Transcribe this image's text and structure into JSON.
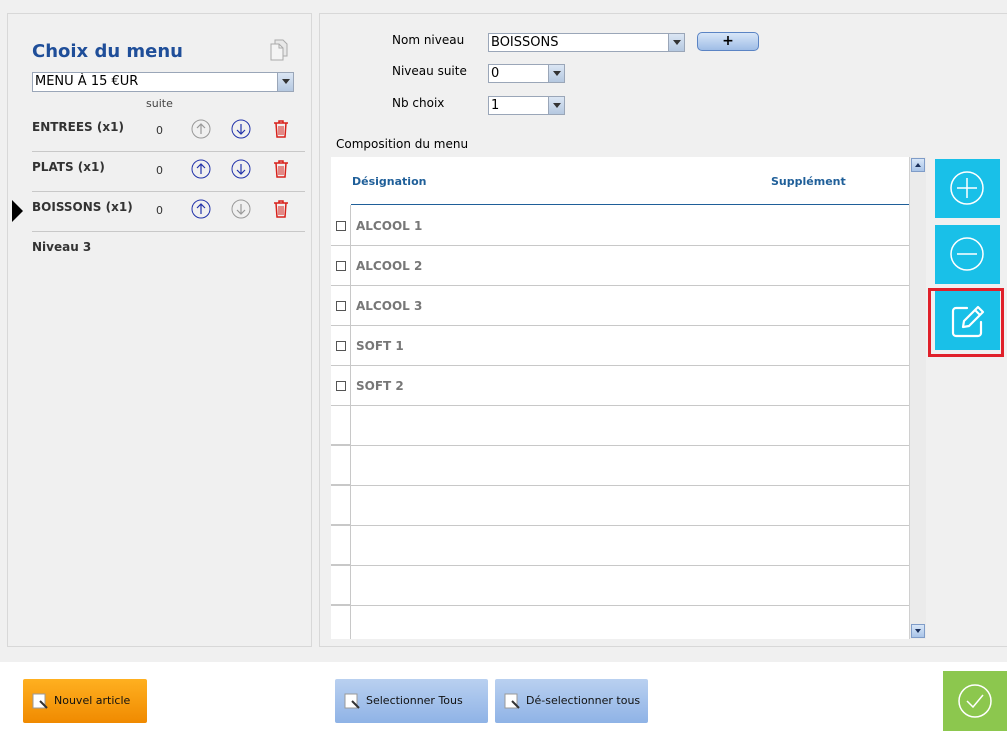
{
  "left": {
    "title": "Choix du menu",
    "menu_select": "MENU À 15 €UR",
    "suite_header": "suite",
    "levels": [
      {
        "label": "ENTREES  (x1)",
        "suite": "0"
      },
      {
        "label": "PLATS  (x1)",
        "suite": "0"
      },
      {
        "label": "BOISSONS  (x1)",
        "suite": "0",
        "selected": true
      }
    ],
    "next_level": "Niveau 3"
  },
  "form": {
    "nom_niveau_label": "Nom niveau",
    "nom_niveau_value": "BOISSONS",
    "niveau_suite_label": "Niveau suite",
    "niveau_suite_value": "0",
    "nb_choix_label": "Nb choix",
    "nb_choix_value": "1",
    "add_label": "+"
  },
  "composition": {
    "label": "Composition du menu",
    "col_designation": "Désignation",
    "col_supplement": "Supplément",
    "rows": [
      "ALCOOL 1",
      "ALCOOL 2",
      "ALCOOL 3",
      "SOFT 1",
      "SOFT 2"
    ]
  },
  "side_buttons": [
    "plus-circle-icon",
    "minus-circle-icon",
    "edit-icon"
  ],
  "bottom": {
    "new_article": "Nouvel article",
    "select_all": "Selectionner Tous",
    "deselect_all": "Dé-selectionner tous"
  },
  "colors": {
    "title_blue": "#1f4e99",
    "cyan_button": "#19c0e8",
    "highlight_red": "#e0202a",
    "ok_green": "#8cc74e",
    "orange": "#f08a00"
  }
}
